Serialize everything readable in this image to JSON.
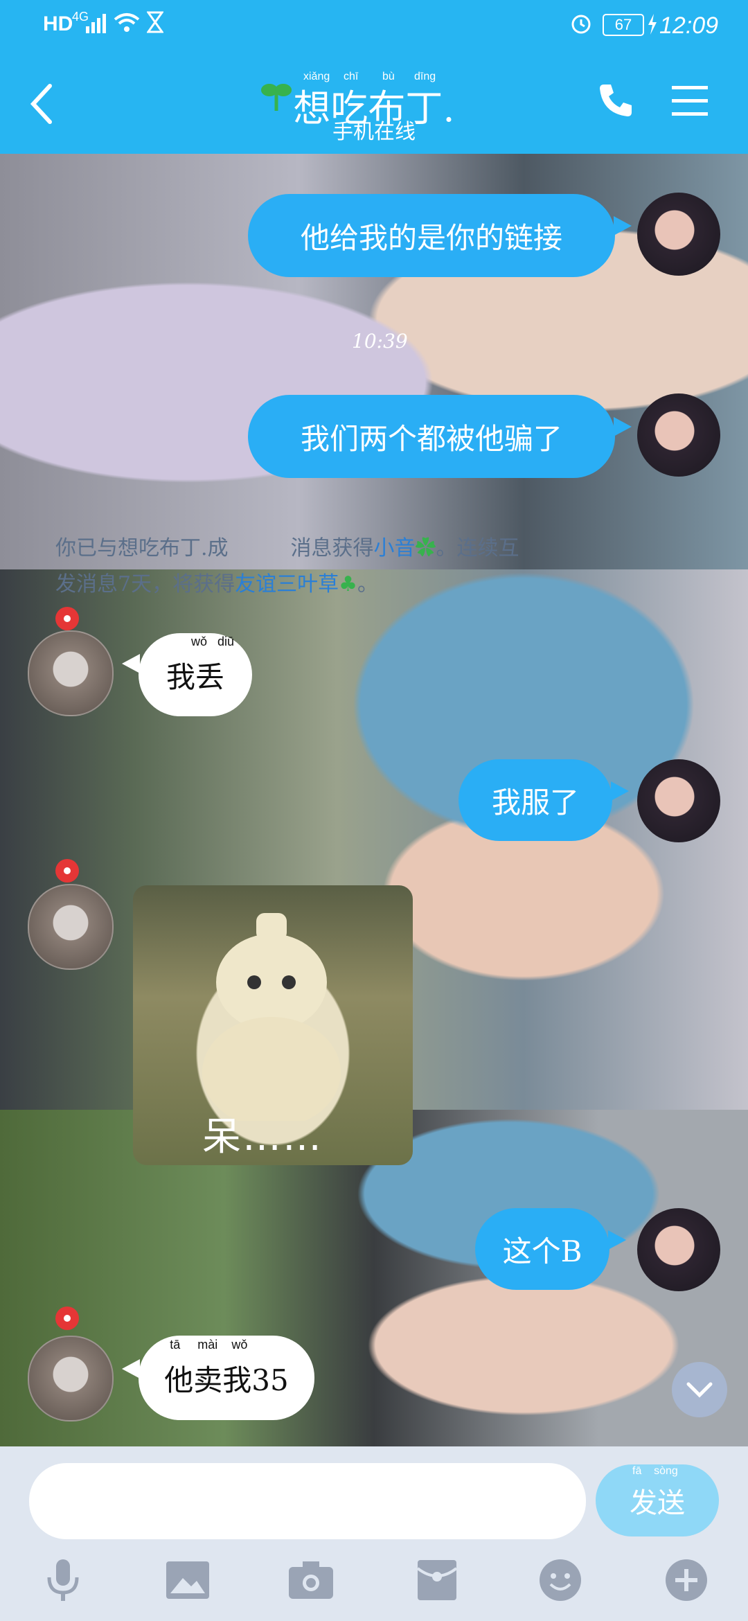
{
  "status_bar": {
    "network_hd": "HD",
    "network_4g": "4G",
    "battery": "67",
    "time": "12:09"
  },
  "header": {
    "title": "想吃布丁.",
    "title_pinyin": [
      "xiǎng",
      "chī",
      "bù",
      "dīng"
    ],
    "subtitle": "手机在线",
    "back_icon": "chevron-left-icon",
    "call_icon": "phone-icon",
    "menu_icon": "menu-icon"
  },
  "chat": {
    "time_label": "10:39",
    "system_message": {
      "line1_prefix": "你已与想吃布丁.成",
      "line1_middle": "消息获得",
      "line1_link": "小音",
      "line1_suffix": "。连续互",
      "line2_prefix": "发消息7天，将获得",
      "line2_link": "友谊三叶草",
      "line2_suffix": "。"
    },
    "messages": [
      {
        "side": "me",
        "text": "他给我的是你的链接"
      },
      {
        "side": "me",
        "text": "我们两个都被他骗了"
      },
      {
        "side": "them",
        "text": "我丢",
        "pinyin": [
          "wǒ",
          "diū"
        ]
      },
      {
        "side": "me",
        "text": "我服了"
      },
      {
        "side": "them",
        "type": "sticker",
        "text": "呆……"
      },
      {
        "side": "me",
        "text": "这个B"
      },
      {
        "side": "them",
        "text": "他卖我35",
        "pinyin": [
          "tā",
          "mài",
          "wǒ"
        ]
      }
    ]
  },
  "input": {
    "placeholder": "",
    "send_label": "发送",
    "send_pinyin": [
      "fā",
      "sòng"
    ]
  },
  "toolbar": {
    "icons": [
      "microphone-icon",
      "image-icon",
      "camera-icon",
      "red-packet-icon",
      "emoji-icon",
      "plus-icon"
    ]
  },
  "colors": {
    "header": "#27b5f2",
    "my_bubble": "#2aaef5",
    "their_bubble": "#ffffff",
    "send_button": "#8fd8f7"
  }
}
